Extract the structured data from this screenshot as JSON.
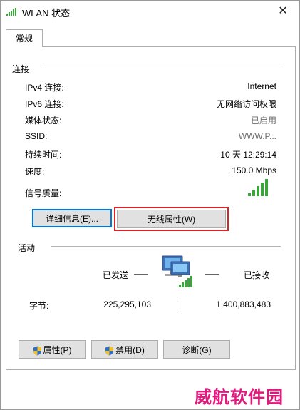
{
  "window": {
    "title": "WLAN 状态",
    "close_glyph": "✕"
  },
  "tab": {
    "label": "常规"
  },
  "connection": {
    "group_label": "连接",
    "rows": [
      {
        "label": "IPv4 连接:",
        "value": "Internet"
      },
      {
        "label": "IPv6 连接:",
        "value": "无网络访问权限"
      },
      {
        "label": "媒体状态:",
        "value": "已启用"
      },
      {
        "label": "SSID:",
        "value": "WWW.P..."
      },
      {
        "label": "持续时间:",
        "value": "10 天 12:29:14"
      },
      {
        "label": "速度:",
        "value": "150.0 Mbps"
      },
      {
        "label": "信号质量:",
        "signal_bars": 5
      }
    ],
    "details_button": "详细信息(E)...",
    "wireless_props_button": "无线属性(W)"
  },
  "activity": {
    "group_label": "活动",
    "sent_label": "已发送",
    "received_label": "已接收",
    "bytes_label": "字节:",
    "bytes_sent": "225,295,103",
    "bytes_received": "1,400,883,483"
  },
  "bottom_buttons": {
    "properties": "属性(P)",
    "disable": "禁用(D)",
    "diagnose": "诊断(G)"
  },
  "watermark": "威航软件园",
  "colors": {
    "highlight_red": "#d7262a",
    "signal_green": "#3aa53a",
    "focus_blue": "#0078d7",
    "watermark_pink": "#e0197d"
  }
}
